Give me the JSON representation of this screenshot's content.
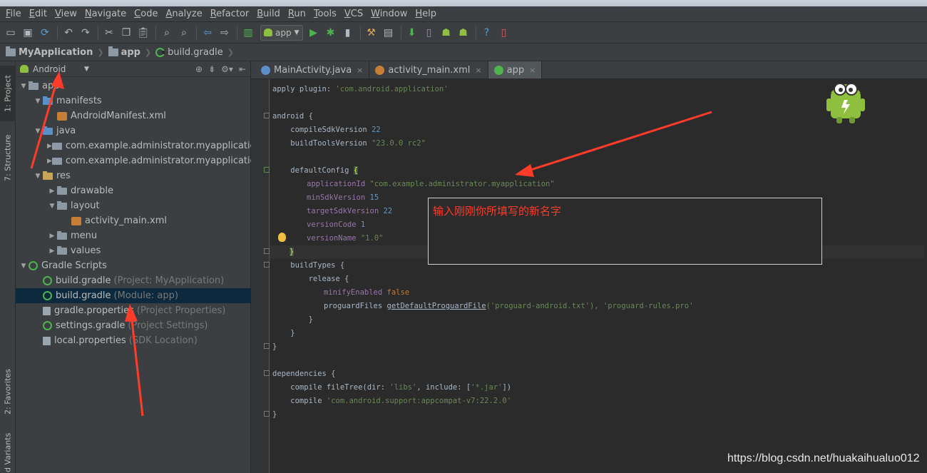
{
  "menubar": {
    "items": [
      "File",
      "Edit",
      "View",
      "Navigate",
      "Code",
      "Analyze",
      "Refactor",
      "Build",
      "Run",
      "Tools",
      "VCS",
      "Window",
      "Help"
    ]
  },
  "toolbar": {
    "run_config": "app",
    "icons": [
      "open-icon",
      "save-icon",
      "sync-icon",
      "undo-icon",
      "redo-icon",
      "cut-icon",
      "copy-icon",
      "paste-icon",
      "find-icon",
      "replace-icon",
      "back-icon",
      "forward-icon",
      "make-icon",
      "run-icon",
      "debug-icon",
      "attach-icon",
      "project-structure-icon",
      "avd-icon",
      "sdk-icon",
      "monitor-icon",
      "help-icon",
      "device-icon"
    ]
  },
  "navbar": {
    "crumbs": [
      "MyApplication",
      "app",
      "build.gradle"
    ]
  },
  "left_strip": {
    "project_tab": "1: Project",
    "structure_tab": "7: Structure",
    "favorites_tab": "2: Favorites",
    "variants_tab": "d Variants"
  },
  "project_panel": {
    "view_mode": "Android",
    "tree": [
      {
        "label": "app",
        "hint": "",
        "indent": 0,
        "arrow": "▼",
        "icon": "folder"
      },
      {
        "label": "manifests",
        "hint": "",
        "indent": 1,
        "arrow": "▼",
        "icon": "folder-blue"
      },
      {
        "label": "AndroidManifest.xml",
        "hint": "",
        "indent": 2,
        "arrow": "",
        "icon": "xml"
      },
      {
        "label": "java",
        "hint": "",
        "indent": 1,
        "arrow": "▼",
        "icon": "folder-blue"
      },
      {
        "label": "com.example.administrator.myapplication_",
        "hint": "",
        "indent": 2,
        "arrow": "▶",
        "icon": "pkg"
      },
      {
        "label": "com.example.administrator.myapplication_",
        "hint": "",
        "indent": 2,
        "arrow": "▶",
        "icon": "pkg"
      },
      {
        "label": "res",
        "hint": "",
        "indent": 1,
        "arrow": "▼",
        "icon": "folder-res"
      },
      {
        "label": "drawable",
        "hint": "",
        "indent": 2,
        "arrow": "▶",
        "icon": "folder"
      },
      {
        "label": "layout",
        "hint": "",
        "indent": 2,
        "arrow": "▼",
        "icon": "folder"
      },
      {
        "label": "activity_main.xml",
        "hint": "",
        "indent": 3,
        "arrow": "",
        "icon": "xml"
      },
      {
        "label": "menu",
        "hint": "",
        "indent": 2,
        "arrow": "▶",
        "icon": "folder"
      },
      {
        "label": "values",
        "hint": "",
        "indent": 2,
        "arrow": "▶",
        "icon": "folder"
      },
      {
        "label": "Gradle Scripts",
        "hint": "",
        "indent": 0,
        "arrow": "▼",
        "icon": "gradle"
      },
      {
        "label": "build.gradle",
        "hint": "(Project: MyApplication)",
        "indent": 1,
        "arrow": "",
        "icon": "gradle"
      },
      {
        "label": "build.gradle",
        "hint": "(Module: app)",
        "indent": 1,
        "arrow": "",
        "icon": "gradle",
        "selected": true
      },
      {
        "label": "gradle.properties",
        "hint": "(Project Properties)",
        "indent": 1,
        "arrow": "",
        "icon": "props"
      },
      {
        "label": "settings.gradle",
        "hint": "(Project Settings)",
        "indent": 1,
        "arrow": "",
        "icon": "gradle"
      },
      {
        "label": "local.properties",
        "hint": "(SDK Location)",
        "indent": 1,
        "arrow": "",
        "icon": "props"
      }
    ]
  },
  "editor_tabs": [
    {
      "label": "MainActivity.java",
      "icon_color": "#5b8fc9",
      "active": false
    },
    {
      "label": "activity_main.xml",
      "icon_color": "#c77e36",
      "active": false
    },
    {
      "label": "app",
      "icon_color": "#4fb34f",
      "active": true
    }
  ],
  "code": {
    "l1": {
      "a": "apply plugin: ",
      "b": "'com.android.application'"
    },
    "l3": "android {",
    "l4": {
      "a": "    compileSdkVersion ",
      "b": "22"
    },
    "l5": {
      "a": "    buildToolsVersion ",
      "b": "\"23.0.0 rc2\""
    },
    "l7": {
      "a": "    defaultConfig ",
      "b": "{"
    },
    "l8": {
      "a": "applicationId ",
      "b": "\"com.example.administrator.myapplication\""
    },
    "l9": {
      "a": "minSdkVersion ",
      "b": "15"
    },
    "l10": {
      "a": "targetSdkVersion ",
      "b": "22"
    },
    "l11": {
      "a": "versionCode ",
      "b": "1"
    },
    "l12": {
      "a": "versionName ",
      "b": "\"1.0\""
    },
    "l13": "}",
    "l14": "    buildTypes {",
    "l15": "        release {",
    "l16": {
      "a": "minifyEnabled ",
      "b": "false"
    },
    "l17": {
      "a": "proguardFiles ",
      "b": "getDefaultProguardFile",
      "c": "('proguard-android.txt'), 'proguard-rules.pro'"
    },
    "l18": "        }",
    "l19": "    }",
    "l20": "}",
    "l22": "dependencies {",
    "l23": {
      "a": "    compile fileTree(dir: ",
      "b": "'libs'",
      "c": ", include: [",
      "d": "'*.jar'",
      "e": "])"
    },
    "l24": {
      "a": "    compile ",
      "b": "'com.android.support:appcompat-v7:22.2.0'"
    },
    "l25": "}"
  },
  "annotation": {
    "text": "输入刚刚你所填写的新名字"
  },
  "watermark": "https://blog.csdn.net/huakaihualuo012",
  "colors": {
    "arrow": "#ff3b2a",
    "accent_green": "#4fb34f",
    "selection": "#0d293e"
  }
}
